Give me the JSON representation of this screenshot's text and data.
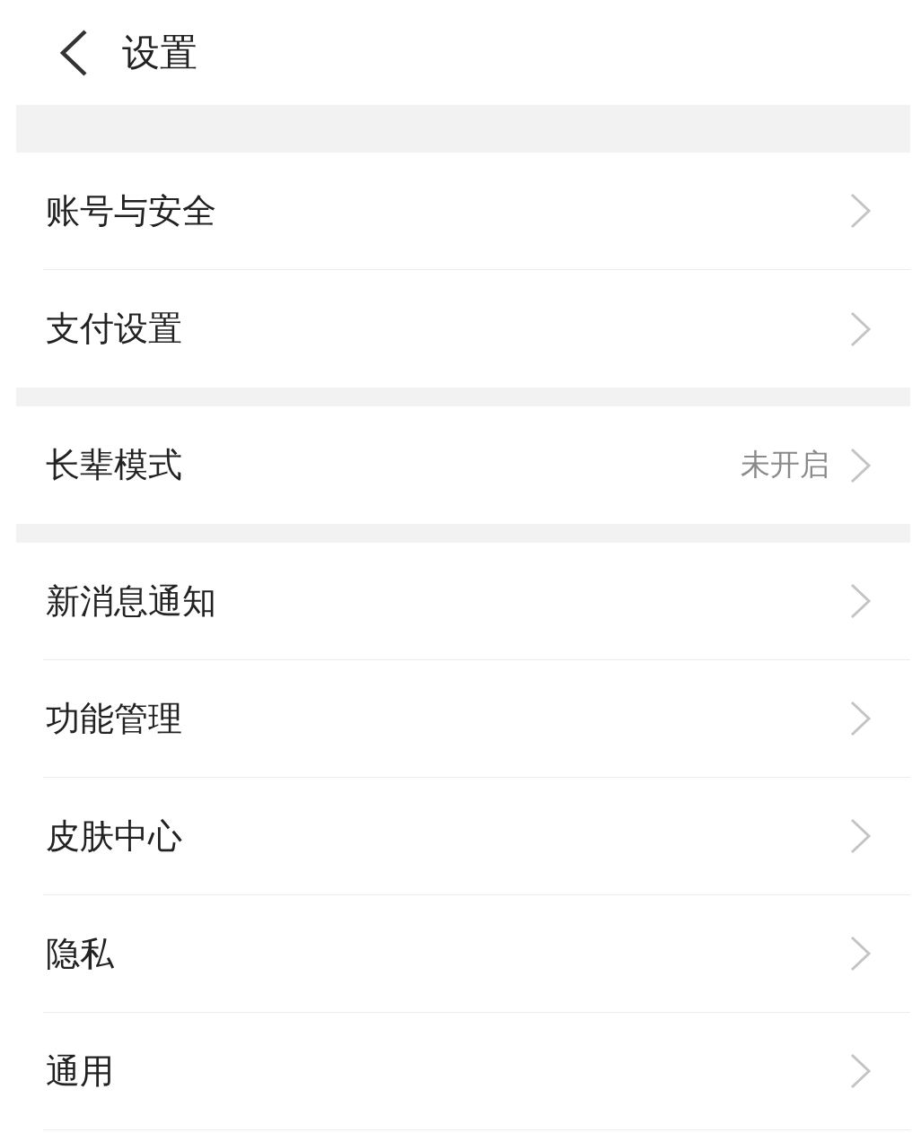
{
  "header": {
    "title": "设置"
  },
  "groups": [
    {
      "items": [
        {
          "label": "账号与安全"
        },
        {
          "label": "支付设置"
        }
      ]
    },
    {
      "items": [
        {
          "label": "长辈模式",
          "value": "未开启"
        }
      ]
    },
    {
      "items": [
        {
          "label": "新消息通知"
        },
        {
          "label": "功能管理"
        },
        {
          "label": "皮肤中心"
        },
        {
          "label": "隐私"
        },
        {
          "label": "通用"
        }
      ]
    }
  ]
}
